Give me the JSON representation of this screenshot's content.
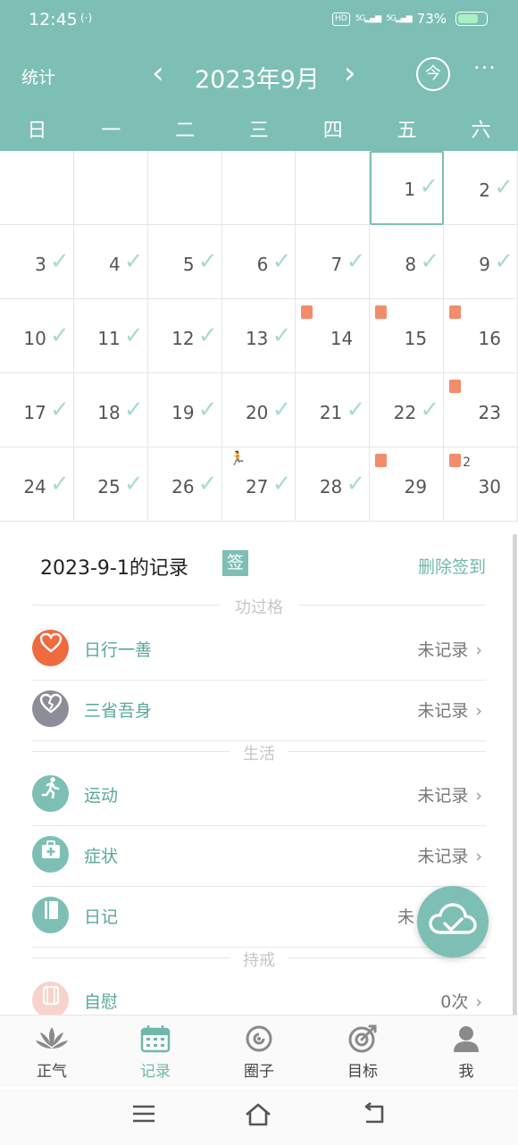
{
  "status_bar": {
    "time": "12:45",
    "nfc": "(·)",
    "hd": "HD",
    "net1": "5G",
    "net2": "5G",
    "battery": "73%",
    "battery_level": 0.73
  },
  "nav": {
    "stats_label": "统计",
    "prev": "‹",
    "title": "2023年9月",
    "next": "›",
    "today_label": "今",
    "more": "···"
  },
  "weekdays": [
    "日",
    "一",
    "二",
    "三",
    "四",
    "五",
    "六"
  ],
  "calendar": {
    "cells": [
      {
        "day": ""
      },
      {
        "day": ""
      },
      {
        "day": ""
      },
      {
        "day": ""
      },
      {
        "day": ""
      },
      {
        "day": "1",
        "check": true,
        "selected": true
      },
      {
        "day": "2",
        "check": true
      },
      {
        "day": "3",
        "check": true
      },
      {
        "day": "4",
        "check": true
      },
      {
        "day": "5",
        "check": true
      },
      {
        "day": "6",
        "check": true
      },
      {
        "day": "7",
        "check": true
      },
      {
        "day": "8",
        "check": true
      },
      {
        "day": "9",
        "check": true
      },
      {
        "day": "10",
        "check": true
      },
      {
        "day": "11",
        "check": true
      },
      {
        "day": "12",
        "check": true
      },
      {
        "day": "13",
        "check": true
      },
      {
        "day": "14",
        "check": false,
        "marker": true
      },
      {
        "day": "15",
        "check": false,
        "marker": true
      },
      {
        "day": "16",
        "check": false,
        "marker": true
      },
      {
        "day": "17",
        "check": true
      },
      {
        "day": "18",
        "check": true
      },
      {
        "day": "19",
        "check": true
      },
      {
        "day": "20",
        "check": true
      },
      {
        "day": "21",
        "check": true
      },
      {
        "day": "22",
        "check": true
      },
      {
        "day": "23",
        "check": false,
        "marker": true
      },
      {
        "day": "24",
        "check": true
      },
      {
        "day": "25",
        "check": true
      },
      {
        "day": "26",
        "check": true
      },
      {
        "day": "27",
        "check": true,
        "run": true
      },
      {
        "day": "28",
        "check": true
      },
      {
        "day": "29",
        "check": false,
        "marker": true
      },
      {
        "day": "30",
        "check": false,
        "marker": true,
        "marker_count": "2"
      }
    ]
  },
  "records": {
    "title": "2023-9-1的记录",
    "badge": "签",
    "delete_label": "删除签到",
    "sections": {
      "merit": "功过格",
      "life": "生活",
      "precept": "持戒"
    },
    "rows": [
      {
        "label": "日行一善",
        "value": "未记录",
        "icon": "heart-icon",
        "color": "#ef6a3e"
      },
      {
        "label": "三省吾身",
        "value": "未记录",
        "icon": "broken-heart-icon",
        "color": "#8d8d99"
      },
      {
        "label": "运动",
        "value": "未记录",
        "icon": "running-icon",
        "color": "#7dbfb4"
      },
      {
        "label": "症状",
        "value": "未记录",
        "icon": "medical-kit-icon",
        "color": "#7dbfb4"
      },
      {
        "label": "日记",
        "value": "未",
        "icon": "diary-icon",
        "color": "#7dbfb4"
      },
      {
        "label": "自慰",
        "value": "0次",
        "icon": "tissue-icon",
        "color": "#f8d3cb"
      }
    ],
    "chevron": "›"
  },
  "tabs": [
    {
      "label": "正气",
      "icon": "lotus-icon"
    },
    {
      "label": "记录",
      "icon": "calendar-icon",
      "active": true
    },
    {
      "label": "圈子",
      "icon": "circle-icon"
    },
    {
      "label": "目标",
      "icon": "target-icon"
    },
    {
      "label": "我",
      "icon": "user-icon"
    }
  ],
  "colors": {
    "primary": "#7dbfb4",
    "check": "#a9dad4",
    "marker": "#f28c6b"
  }
}
